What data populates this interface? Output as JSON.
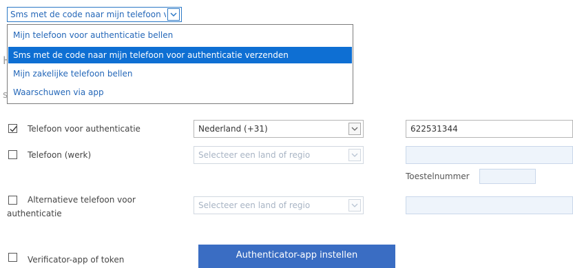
{
  "method_select": {
    "value": "Sms met de code naar mijn telefoon voor authenticatie verzenden",
    "options": [
      "Mijn telefoon voor authenticatie bellen",
      "Sms met de code naar mijn telefoon voor authenticatie verzenden",
      "Mijn zakelijke telefoon bellen",
      "Waarschuwen via app"
    ],
    "selected_index": 1
  },
  "background_fragments": {
    "h": "H",
    "s": "s"
  },
  "rows": {
    "auth_phone": {
      "label": "Telefoon voor authenticatie",
      "checked": true,
      "country": "Nederland (+31)",
      "number": "622531344"
    },
    "work_phone": {
      "label": "Telefoon (werk)",
      "checked": false,
      "country_placeholder": "Selecteer een land of regio",
      "extension_label": "Toestelnummer"
    },
    "alt_phone": {
      "label_line1": "Alternatieve telefoon voor",
      "label_line2": "authenticatie",
      "checked": false,
      "country_placeholder": "Selecteer een land of regio"
    },
    "authenticator": {
      "label": "Verificator-app of token",
      "checked": false,
      "button_label": "Authenticator-app instellen"
    }
  },
  "colors": {
    "accent_blue": "#0e6fd3",
    "button_blue": "#3a6dc3",
    "link_blue": "#2467b8"
  }
}
